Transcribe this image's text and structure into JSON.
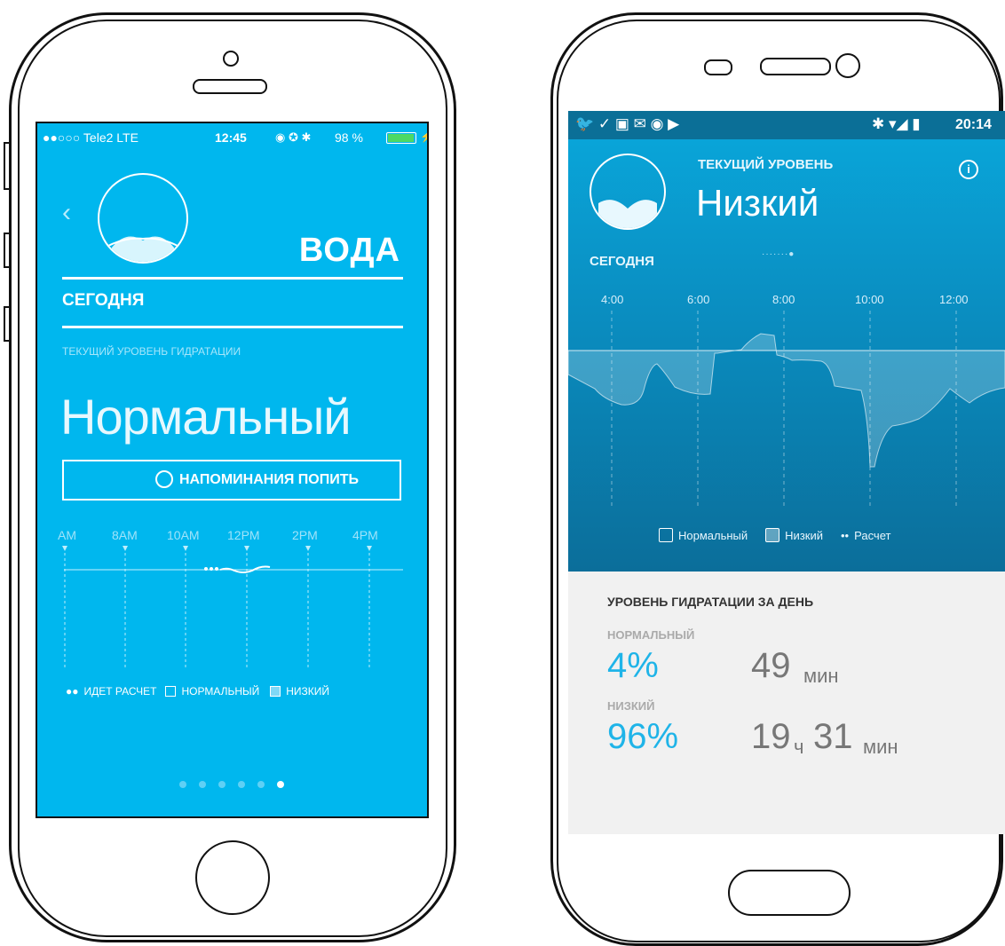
{
  "ios": {
    "status": {
      "carrier": "●●○○○ Tele2  LTE",
      "time": "12:45",
      "battery": "98 %"
    },
    "title": "ВОДА",
    "today": "СЕГОДНЯ",
    "hydration_caption": "ТЕКУЩИЙ УРОВЕНЬ ГИДРАТАЦИИ",
    "level": "Нормальный",
    "reminder_button": "НАПОМИНАНИЯ ПОПИТЬ",
    "ticks": [
      "AM",
      "8AM",
      "10AM",
      "12PM",
      "2PM",
      "4PM"
    ],
    "legend": {
      "calc": "ИДЕТ РАСЧЕТ",
      "normal": "НОРМАЛЬНЫЙ",
      "low": "НИЗКИЙ"
    },
    "page_dots_total": 6,
    "page_dots_active": 6
  },
  "android": {
    "status": {
      "time": "20:14"
    },
    "current_level_label": "ТЕКУЩИЙ УРОВЕНЬ",
    "current_level": "Низкий",
    "today": "СЕГОДНЯ",
    "ticks": [
      "4:00",
      "6:00",
      "8:00",
      "10:00",
      "12:00"
    ],
    "legend": {
      "normal": "Нормальный",
      "low": "Низкий",
      "calc": "Расчет"
    },
    "summary_title": "УРОВЕНЬ ГИДРАТАЦИИ ЗА ДЕНЬ",
    "normal_label": "НОРМАЛЬНЫЙ",
    "normal_pct": "4%",
    "normal_time_num": "49",
    "normal_time_unit": "мин",
    "low_label": "НИЗКИЙ",
    "low_pct": "96%",
    "low_h_num": "19",
    "low_h_unit": "ч",
    "low_m_num": "31",
    "low_m_unit": "мин"
  },
  "colors": {
    "ios_bg": "#00b7ee",
    "accent": "#1fb4e8",
    "android_grey": "#f1f1f1"
  }
}
